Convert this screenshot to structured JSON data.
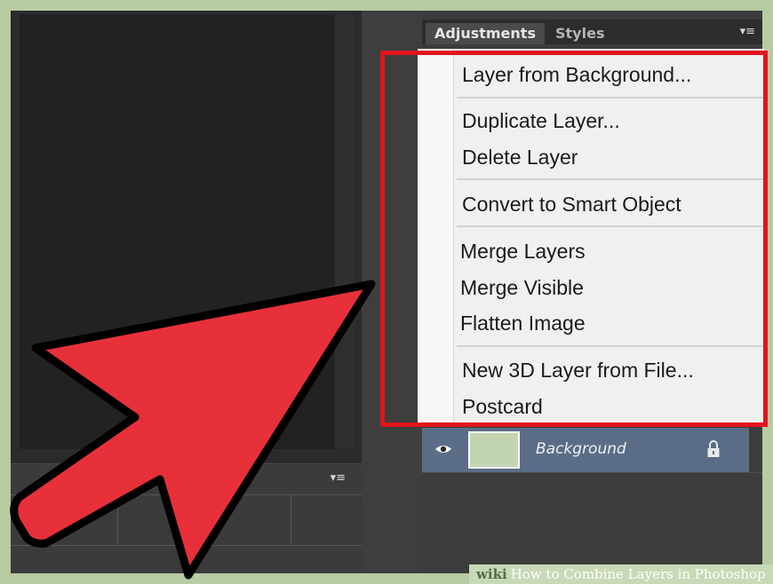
{
  "panel": {
    "tabs": [
      {
        "label": "Adjustments",
        "active": true
      },
      {
        "label": "Styles",
        "active": false
      }
    ],
    "menu_icon": "panel-menu-icon"
  },
  "context_menu": {
    "groups": [
      [
        "Layer from Background..."
      ],
      [
        "Duplicate Layer...",
        "Delete Layer"
      ],
      [
        "Convert to Smart Object"
      ],
      [
        "Merge Layers",
        "Merge Visible",
        "Flatten Image"
      ],
      [
        "New 3D Layer from File...",
        "Postcard"
      ]
    ],
    "highlight_color": "#e1141b"
  },
  "layers": {
    "background": {
      "name": "Background",
      "visible_icon": "eye-icon",
      "locked_icon": "lock-icon",
      "thumb_color": "#c3d5b0"
    }
  },
  "annotation": {
    "arrow_color": "#e8303a",
    "arrow_outline": "#000000"
  },
  "watermark": {
    "brand": "wiki",
    "text": "How to Combine Layers in Photoshop"
  }
}
